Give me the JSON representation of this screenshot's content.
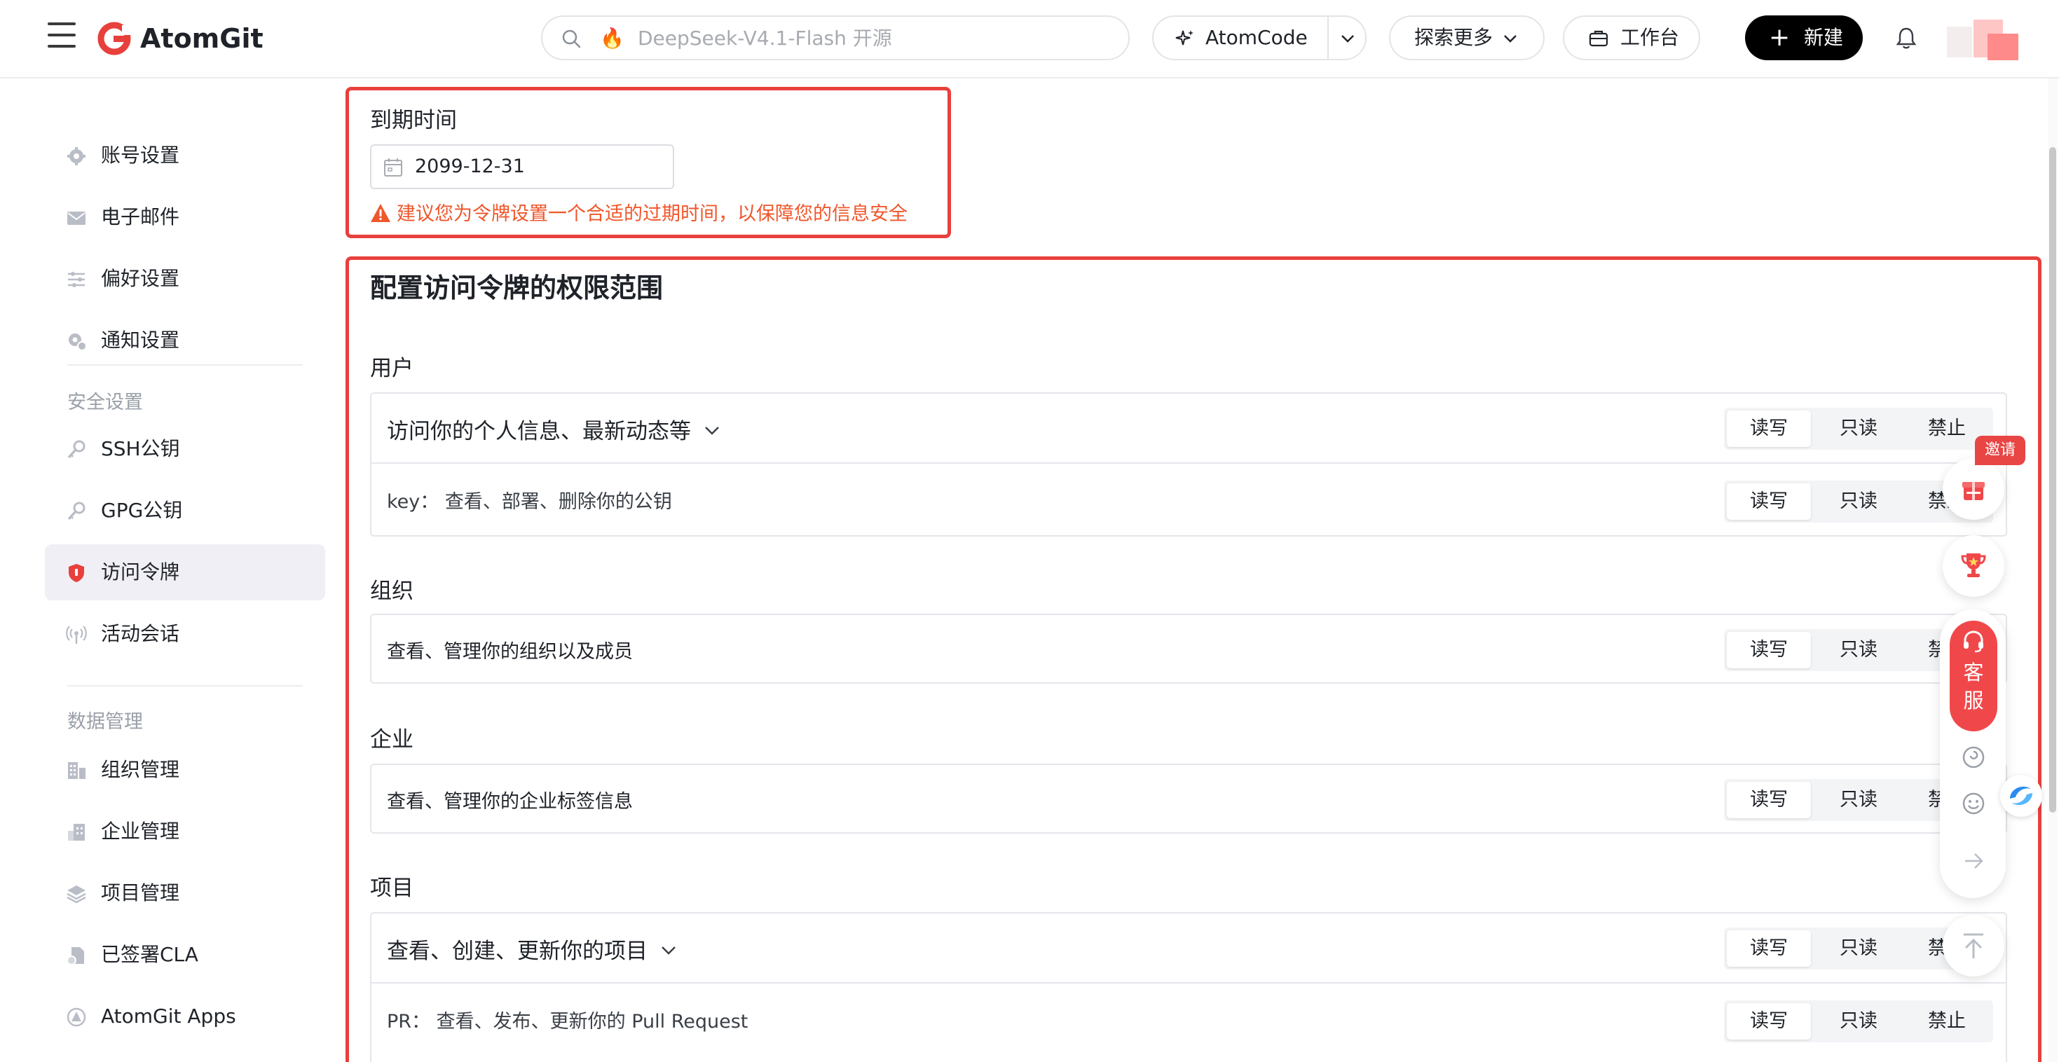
{
  "header": {
    "brand": "AtomGit",
    "search_placeholder": "DeepSeek-V4.1-Flash 开源",
    "atomcode_label": "AtomCode",
    "explore_label": "探索更多",
    "workbench_label": "工作台",
    "new_label": "新建"
  },
  "sidebar": {
    "items_top": [
      {
        "label": "账号设置",
        "icon": "gear-icon"
      },
      {
        "label": "电子邮件",
        "icon": "mail-icon"
      },
      {
        "label": "偏好设置",
        "icon": "sliders-icon"
      },
      {
        "label": "通知设置",
        "icon": "notify-gear-icon"
      }
    ],
    "security_section": "安全设置",
    "items_security": [
      {
        "label": "SSH公钥",
        "icon": "key-icon"
      },
      {
        "label": "GPG公钥",
        "icon": "key-icon"
      },
      {
        "label": "访问令牌",
        "icon": "shield-icon",
        "active": true
      },
      {
        "label": "活动会话",
        "icon": "broadcast-icon"
      }
    ],
    "data_section": "数据管理",
    "items_data": [
      {
        "label": "组织管理",
        "icon": "building-icon"
      },
      {
        "label": "企业管理",
        "icon": "enterprise-icon"
      },
      {
        "label": "项目管理",
        "icon": "layers-icon"
      },
      {
        "label": "已签署CLA",
        "icon": "document-icon"
      },
      {
        "label": "AtomGit Apps",
        "icon": "apps-icon"
      }
    ]
  },
  "expire": {
    "label": "到期时间",
    "date_value": "2099-12-31",
    "warning": "建议您为令牌设置一个合适的过期时间，以保障您的信息安全"
  },
  "scope": {
    "title": "配置访问令牌的权限范围",
    "options": [
      "读写",
      "只读",
      "禁止"
    ],
    "groups": [
      {
        "label": "用户",
        "main": "访问你的个人信息、最新动态等",
        "expandable": true,
        "sub": [
          "key： 查看、部署、删除你的公钥"
        ]
      },
      {
        "label": "组织",
        "main": "查看、管理你的组织以及成员",
        "expandable": false,
        "sub": []
      },
      {
        "label": "企业",
        "main": "查看、管理你的企业标签信息",
        "expandable": false,
        "sub": []
      },
      {
        "label": "项目",
        "main": "查看、创建、更新你的项目",
        "expandable": true,
        "sub": [
          "PR： 查看、发布、更新你的 Pull Request"
        ]
      }
    ]
  },
  "float": {
    "invite": "邀请",
    "service_line1": "客",
    "service_line2": "服"
  },
  "colors": {
    "highlight": "#e8403c",
    "warning": "#f0562b",
    "primary_button": "#000000",
    "service": "#f0484a"
  }
}
